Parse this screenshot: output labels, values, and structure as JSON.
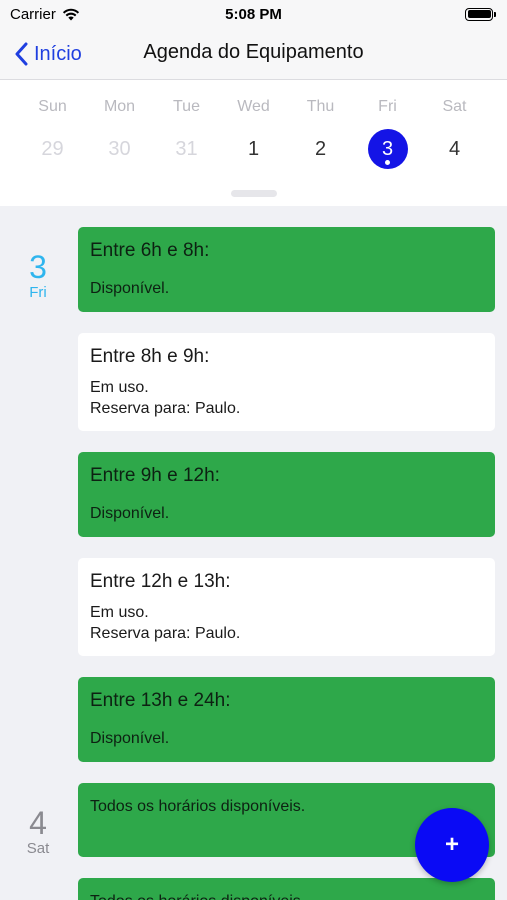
{
  "status_bar": {
    "carrier": "Carrier",
    "time": "5:08 PM"
  },
  "nav": {
    "back_label": "Início",
    "title": "Agenda do Equipamento"
  },
  "week": [
    {
      "day": "Sun",
      "num": "29",
      "state": "faded"
    },
    {
      "day": "Mon",
      "num": "30",
      "state": "faded"
    },
    {
      "day": "Tue",
      "num": "31",
      "state": "faded"
    },
    {
      "day": "Wed",
      "num": "1",
      "state": "normal"
    },
    {
      "day": "Thu",
      "num": "2",
      "state": "normal"
    },
    {
      "day": "Fri",
      "num": "3",
      "state": "selected"
    },
    {
      "day": "Sat",
      "num": "4",
      "state": "normal"
    }
  ],
  "agenda": {
    "fri": {
      "num": "3",
      "day": "Fri"
    },
    "sat": {
      "num": "4",
      "day": "Sat"
    },
    "slots": [
      {
        "title": "Entre 6h e 8h:",
        "status": "Disponível.",
        "type": "free"
      },
      {
        "title": "Entre 8h e 9h:",
        "status": "Em uso.",
        "reservation": "Reserva para: Paulo.",
        "type": "busy"
      },
      {
        "title": "Entre 9h e 12h:",
        "status": "Disponível.",
        "type": "free"
      },
      {
        "title": "Entre 12h e 13h:",
        "status": "Em uso.",
        "reservation": "Reserva para: Paulo.",
        "type": "busy"
      },
      {
        "title": "Entre 13h e 24h:",
        "status": "Disponível.",
        "type": "free"
      }
    ],
    "sat_slot": "Todos os horários disponíveis.",
    "next_slot": "Todos os horários disponíveis."
  },
  "fab": {
    "label": "+"
  },
  "colors": {
    "accent": "#1414e6",
    "available": "#2ea84a",
    "today": "#2fb5ee"
  },
  "icons": [
    "wifi-icon",
    "battery-icon",
    "chevron-left-icon",
    "plus-icon"
  ]
}
